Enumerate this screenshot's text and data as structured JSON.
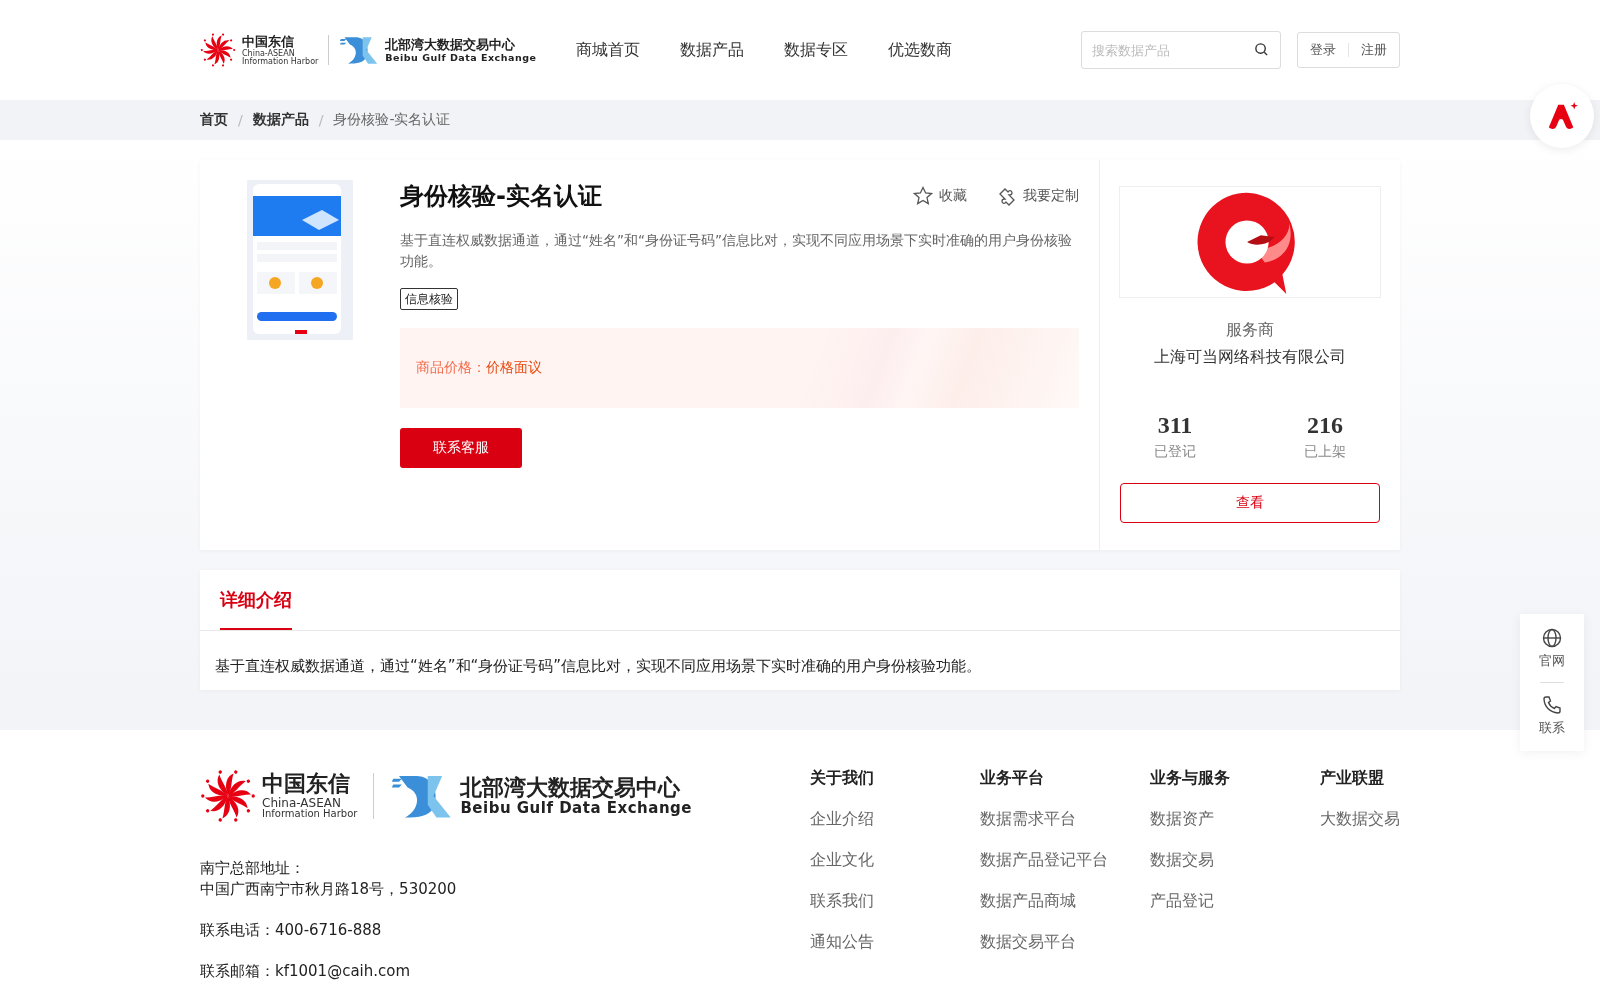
{
  "header": {
    "logo": {
      "cn": "中国东信",
      "en1": "China-ASEAN",
      "en2": "Information Harbor"
    },
    "logo2": {
      "cn": "北部湾大数据交易中心",
      "en": "Beibu Gulf Data Exchange"
    },
    "nav": [
      {
        "label": "商城首页",
        "selected": false
      },
      {
        "label": "数据产品",
        "selected": false
      },
      {
        "label": "数据专区",
        "selected": false
      },
      {
        "label": "优选数商",
        "selected": false
      }
    ],
    "search": {
      "placeholder": "搜索数据产品"
    },
    "auth": [
      "登录",
      "注册"
    ]
  },
  "breadcrumb": [
    {
      "label": "首页",
      "current": false
    },
    {
      "separator": "/",
      "label": "数据产品",
      "current": false
    },
    {
      "separator": "/",
      "label": "身份核验-实名认证",
      "current": true
    }
  ],
  "product": {
    "title": "身份核验-实名认证",
    "actions": [
      {
        "kind": "star",
        "label": "收藏"
      },
      {
        "kind": "custom",
        "label": "我要定制"
      }
    ],
    "description": "基于直连权威数据通道，通过“姓名”和“身份证号码”信息比对，实现不同应用场景下实时准确的用户身份核验功能。",
    "tags": [
      "信息核验"
    ],
    "price_label": "商品价格：",
    "price_value": "价格面议",
    "contact_button": "联系客服"
  },
  "provider": {
    "heading": "服务商",
    "name": "上海可当网络科技有限公司",
    "stats": [
      {
        "value": "311",
        "label": "已登记"
      },
      {
        "value": "216",
        "label": "已上架"
      }
    ],
    "button": "查看"
  },
  "details": {
    "tabs": [
      {
        "label": "详细介绍",
        "selected": true
      }
    ],
    "text": "基于直连权威数据通道，通过“姓名”和“身份证号码”信息比对，实现不同应用场景下实时准确的用户身份核验功能。"
  },
  "footer": {
    "logo": {
      "cn": "中国东信",
      "en1": "China-ASEAN",
      "en2": "Information Harbor"
    },
    "logo2": {
      "cn": "北部湾大数据交易中心",
      "en": "Beibu Gulf Data Exchange"
    },
    "address_label": "南宁总部地址：",
    "address": "中国广西南宁市秋月路18号，530200",
    "phone": "联系电话：400-6716-888",
    "email": "联系邮箱：kf1001@caih.com",
    "columns": [
      {
        "title": "关于我们",
        "links": [
          "企业介绍",
          "企业文化",
          "联系我们",
          "通知公告"
        ]
      },
      {
        "title": "业务平台",
        "links": [
          "数据需求平台",
          "数据产品登记平台",
          "数据产品商城",
          "数据交易平台"
        ]
      },
      {
        "title": "业务与服务",
        "links": [
          "数据资产",
          "数据交易",
          "产品登记"
        ]
      },
      {
        "title": "产业联盟",
        "links": [
          "大数据交易"
        ]
      }
    ]
  },
  "float_tools": [
    {
      "kind": "globe",
      "label": "官网"
    },
    {
      "kind": "phone",
      "label": "联系"
    }
  ]
}
